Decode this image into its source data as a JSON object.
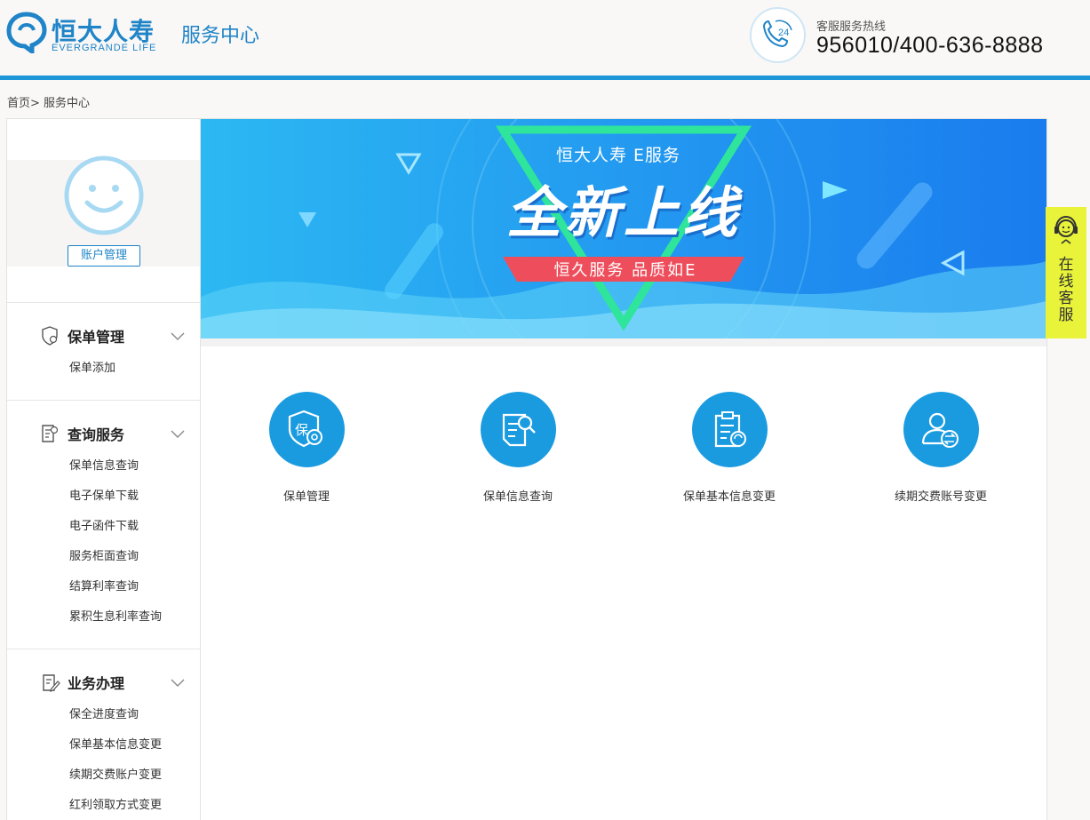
{
  "header": {
    "logo_cn": "恒大人寿",
    "logo_en": "EVERGRANDE LIFE",
    "site_title": "服务中心",
    "hotline_badge": "24",
    "hotline_label": "客服服务热线",
    "hotline_number": "956010/400-636-8888"
  },
  "breadcrumb": "首页> 服务中心",
  "sidebar": {
    "account_button": "账户管理",
    "sections": [
      {
        "title": "保单管理",
        "icon": "policy-shield-icon",
        "items": [
          "保单添加"
        ]
      },
      {
        "title": "查询服务",
        "icon": "query-document-icon",
        "items": [
          "保单信息查询",
          "电子保单下载",
          "电子函件下载",
          "服务柜面查询",
          "结算利率查询",
          "累积生息利率查询"
        ]
      },
      {
        "title": "业务办理",
        "icon": "business-edit-icon",
        "items": [
          "保全进度查询",
          "保单基本信息变更",
          "续期交费账户变更",
          "红利领取方式变更"
        ]
      }
    ]
  },
  "banner": {
    "tag": "恒大人寿  E服务",
    "headline": "全新上线",
    "subline": "恒久服务  品质如E"
  },
  "quick_links": [
    {
      "label": "保单管理",
      "icon": "policy-shield-icon"
    },
    {
      "label": "保单信息查询",
      "icon": "document-search-icon"
    },
    {
      "label": "保单基本信息变更",
      "icon": "clipboard-refresh-icon"
    },
    {
      "label": "续期交费账号变更",
      "icon": "user-exchange-icon"
    }
  ],
  "online_service": "在线客服",
  "colors": {
    "brand": "#1f84c8",
    "accent_blue": "#1a9be0",
    "online_bg": "#e8f33a"
  }
}
